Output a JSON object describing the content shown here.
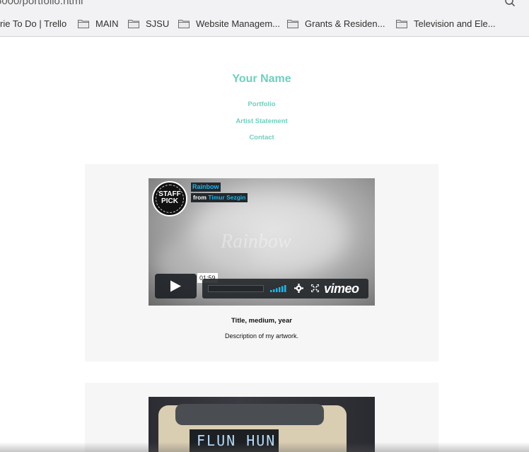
{
  "browser": {
    "url": "5000/portfolio.html",
    "bookmarks": [
      "rie To Do | Trello",
      "MAIN",
      "SJSU",
      "Website Managem...",
      "Grants & Residen...",
      "Television and Ele..."
    ]
  },
  "site": {
    "title": "Your Name",
    "nav": [
      "Portfolio",
      "Artist Statement",
      "Contact"
    ]
  },
  "video": {
    "badge_line1": "STAFF",
    "badge_line2": "PICK",
    "title": "Rainbow",
    "from_label": "from",
    "author": "Timur Sezgin",
    "watermark": "Rainbow",
    "time": "01:59",
    "logo": "vimeo"
  },
  "artwork": {
    "title": "Title, medium, year",
    "description": "Description of my artwork."
  },
  "artwork2": {
    "display_text": "FLUN HUN"
  },
  "colors": {
    "accent": "#6fcfbe",
    "vimeo_blue": "#19b7ea",
    "card_bg": "#f6f6f6"
  }
}
